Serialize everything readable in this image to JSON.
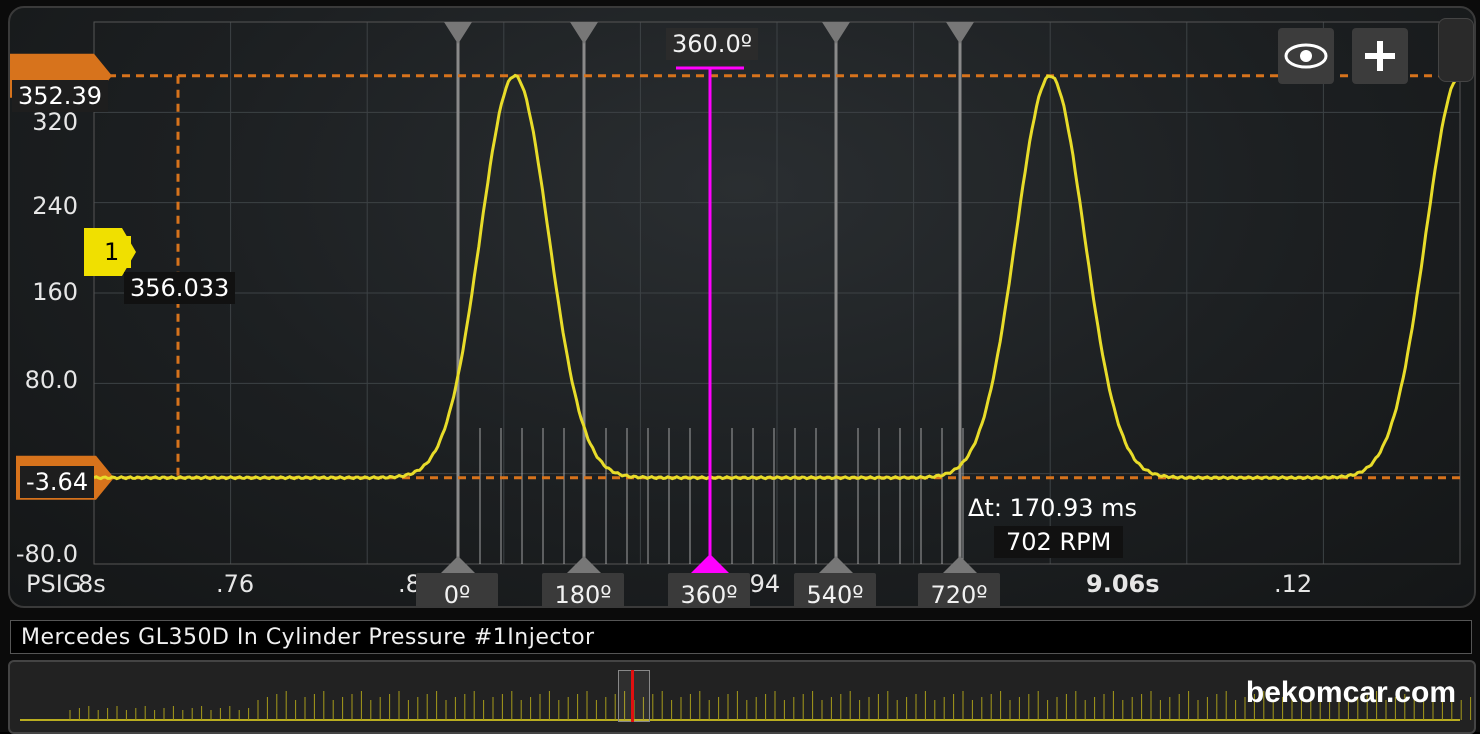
{
  "chart_data": {
    "type": "line",
    "title": "Mercedes GL350D In Cylinder Pressure #1Injector",
    "ylabel": "PSIG",
    "xlabel": "",
    "ylim": [
      -80.0,
      400.0
    ],
    "y_ticks": [
      "320",
      "240",
      "160",
      "80.0",
      "-80.0"
    ],
    "x_ticks": [
      "8s",
      ".76",
      ".8",
      ".94",
      "9.06s",
      ".12"
    ],
    "series": [
      {
        "color": "#e8dc2a",
        "x": [
          8.7,
          8.76,
          8.8,
          8.82,
          8.84,
          8.85,
          8.86,
          8.87,
          8.88,
          8.9,
          8.93,
          8.96,
          9.0,
          9.03,
          9.04,
          9.05,
          9.06,
          9.07,
          9.08,
          9.1,
          9.13,
          9.17,
          9.19,
          9.2,
          9.21
        ],
        "values": [
          -3.6,
          -3.6,
          -3.0,
          5,
          60,
          200,
          350,
          200,
          60,
          2,
          -3.6,
          -3.6,
          -3.6,
          5,
          60,
          200,
          350,
          200,
          60,
          2,
          -3.6,
          -3.6,
          20,
          120,
          340
        ]
      }
    ],
    "cursors": {
      "top_value": "352.39",
      "bottom_value": "-3.64",
      "marker_label": "1",
      "marker_value": "356.033",
      "delta_t": "Δt: 170.93 ms",
      "rpm": "702 RPM",
      "degree_markers": [
        "0º",
        "180º",
        "360º",
        "540º",
        "720º"
      ],
      "active_degree": "360.0º"
    },
    "grid": true
  },
  "controls": {
    "eye_icon": "eye-icon",
    "plus_icon": "plus-icon"
  },
  "watermark": "bekomcar.com",
  "colors": {
    "trace": "#e8dc2a",
    "cursor": "#ff00ff",
    "ref": "#d7731c",
    "marker": "#f0e000"
  }
}
